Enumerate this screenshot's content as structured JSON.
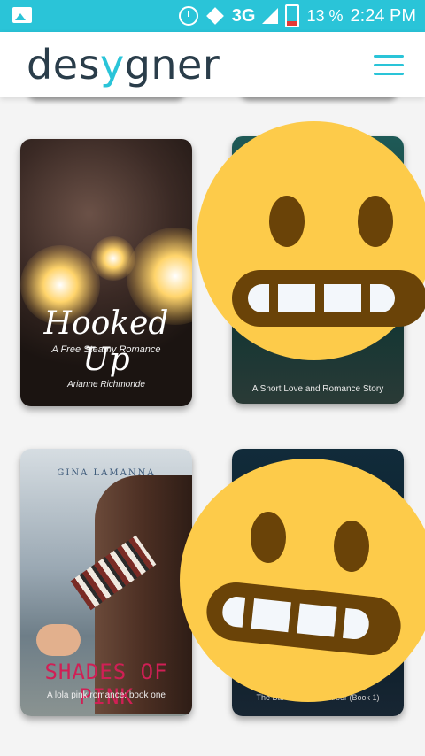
{
  "status_bar": {
    "network": "3G",
    "battery": "13 %",
    "time": "2:24 PM"
  },
  "header": {
    "logo_part1": "des",
    "logo_mark": "y",
    "logo_part2": "gner"
  },
  "books": [
    {
      "title": "Hooked Up",
      "subtitle": "A Free Steamy Romance",
      "author": "Arianne Richmonde"
    },
    {
      "subtitle": "A Short Love and Romance Story"
    },
    {
      "author": "GINA LAMANNA",
      "title": "SHADES OF PINK",
      "subtitle": "A lola pink romance: book one"
    },
    {
      "subtitle": "The Bar at Sunset Harbor (Book 1)"
    }
  ],
  "colors": {
    "accent": "#2ac4d8",
    "emoji": "#fdcb4a",
    "emoji_feature": "#6a4308"
  }
}
